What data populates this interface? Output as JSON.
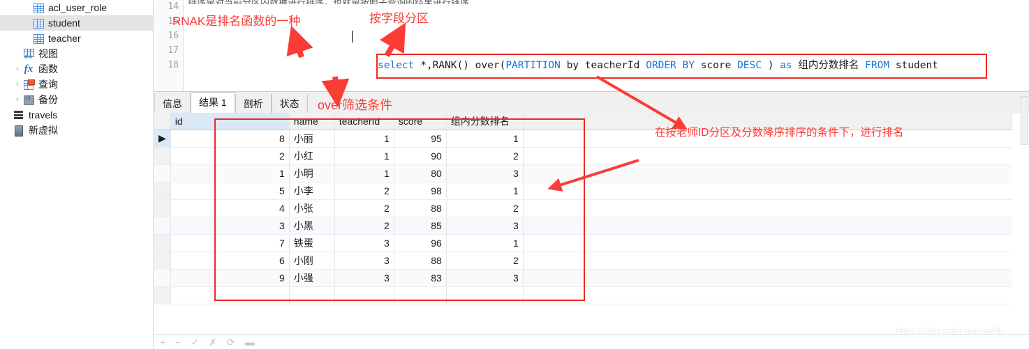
{
  "sidebar": {
    "items": [
      {
        "label": "acl_user_role",
        "icon": "table-icon",
        "indent": 2,
        "arrow": "",
        "selected": false
      },
      {
        "label": "student",
        "icon": "table-icon",
        "indent": 2,
        "arrow": "",
        "selected": true
      },
      {
        "label": "teacher",
        "icon": "table-icon",
        "indent": 2,
        "arrow": "",
        "selected": false
      },
      {
        "label": "视图",
        "icon": "view-icon",
        "indent": 1,
        "arrow": "",
        "selected": false
      },
      {
        "label": "函数",
        "icon": "fx-icon",
        "indent": 1,
        "arrow": "›",
        "selected": false
      },
      {
        "label": "查询",
        "icon": "query-icon",
        "indent": 1,
        "arrow": "›",
        "selected": false
      },
      {
        "label": "备份",
        "icon": "backup-icon",
        "indent": 1,
        "arrow": "›",
        "selected": false
      },
      {
        "label": "travels",
        "icon": "database-icon",
        "indent": 0,
        "arrow": "",
        "selected": false
      },
      {
        "label": "新虚拟",
        "icon": "server-icon",
        "indent": 0,
        "arrow": "",
        "selected": false
      }
    ]
  },
  "editor": {
    "line_numbers": [
      "14",
      "15",
      "16",
      "17",
      "18"
    ],
    "sql_tokens": [
      {
        "text": "select ",
        "kind": "keyword"
      },
      {
        "text": "*,RANK() over(",
        "kind": "plain"
      },
      {
        "text": "PARTITION",
        "kind": "keyword"
      },
      {
        "text": " by teacherId ",
        "kind": "plain"
      },
      {
        "text": "ORDER BY",
        "kind": "keyword"
      },
      {
        "text": " score ",
        "kind": "plain"
      },
      {
        "text": "DESC",
        "kind": "keyword"
      },
      {
        "text": " ) ",
        "kind": "plain"
      },
      {
        "text": "as",
        "kind": "keyword"
      },
      {
        "text": " 组内分数排名 ",
        "kind": "plain"
      },
      {
        "text": "FROM",
        "kind": "keyword"
      },
      {
        "text": " student",
        "kind": "plain"
      }
    ],
    "sql_plain": "select *,RANK() over(PARTITION by teacherId ORDER BY score DESC ) as 组内分数排名 FROM student",
    "keyword_color": "#1874cd",
    "plain_color": "#1b1b1b"
  },
  "tabs": [
    {
      "label": "信息",
      "active": false
    },
    {
      "label": "结果 1",
      "active": true
    },
    {
      "label": "剖析",
      "active": false
    },
    {
      "label": "状态",
      "active": false
    }
  ],
  "result_grid": {
    "columns": [
      "id",
      "name",
      "teacherId",
      "score",
      "组内分数排名"
    ],
    "selected_column": "id",
    "rows": [
      {
        "current": true,
        "id": "8",
        "name": "小丽",
        "teacherId": "1",
        "score": "95",
        "rank": "1"
      },
      {
        "current": false,
        "id": "2",
        "name": "小红",
        "teacherId": "1",
        "score": "90",
        "rank": "2"
      },
      {
        "current": false,
        "id": "1",
        "name": "小明",
        "teacherId": "1",
        "score": "80",
        "rank": "3"
      },
      {
        "current": false,
        "id": "5",
        "name": "小李",
        "teacherId": "2",
        "score": "98",
        "rank": "1"
      },
      {
        "current": false,
        "id": "4",
        "name": "小张",
        "teacherId": "2",
        "score": "88",
        "rank": "2"
      },
      {
        "current": false,
        "id": "3",
        "name": "小黑",
        "teacherId": "2",
        "score": "85",
        "rank": "3"
      },
      {
        "current": false,
        "id": "7",
        "name": "铁蛋",
        "teacherId": "3",
        "score": "96",
        "rank": "1"
      },
      {
        "current": false,
        "id": "6",
        "name": "小刚",
        "teacherId": "3",
        "score": "88",
        "rank": "2"
      },
      {
        "current": false,
        "id": "9",
        "name": "小强",
        "teacherId": "3",
        "score": "83",
        "rank": "3"
      }
    ]
  },
  "annotations": {
    "color": "#fb3b36",
    "rank_note": "RNAK是排名函数的一种",
    "partition_note": "按字段分区",
    "over_note": "over筛选条件",
    "right_note": "在按老师ID分区及分数降序排序的条件下，进行排名"
  },
  "bottom_toolbar": {
    "buttons": [
      "+",
      "−",
      "✓",
      "✗",
      "⟳",
      "▬"
    ]
  },
  "watermark": "https://blog.csdn.net/worilb"
}
